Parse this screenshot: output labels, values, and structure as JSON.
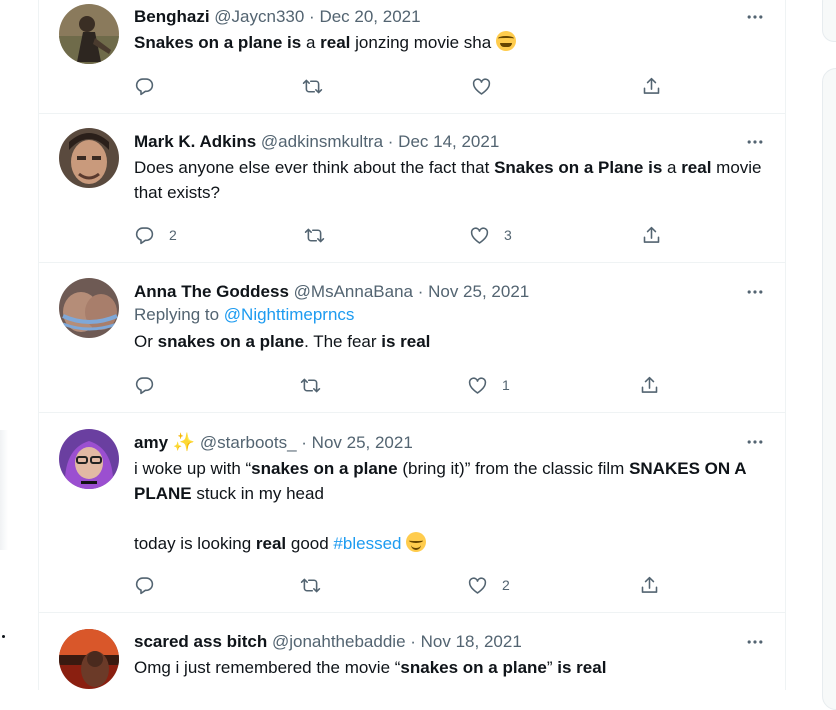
{
  "tweets": [
    {
      "name": "Benghazi",
      "handle": "@Jaycn330",
      "sep": " · ",
      "date": "Dec 20, 2021",
      "text": [
        {
          "t": "Snakes on a plane is",
          "b": true
        },
        {
          "t": " a ",
          "b": false
        },
        {
          "t": "real",
          "b": true
        },
        {
          "t": " jonzing movie sha ",
          "b": false
        }
      ],
      "emoji": "face-with-tears-of-joy",
      "replies": "",
      "retweets": "",
      "likes": ""
    },
    {
      "name": "Mark K. Adkins",
      "handle": "@adkinsmkultra",
      "sep": " · ",
      "date": "Dec 14, 2021",
      "text": [
        {
          "t": "Does anyone else ever think about the fact that ",
          "b": false
        },
        {
          "t": "Snakes on a Plane is",
          "b": true
        },
        {
          "t": " a ",
          "b": false
        },
        {
          "t": "real",
          "b": true
        },
        {
          "t": " movie that exists?",
          "b": false
        }
      ],
      "replies": "2",
      "retweets": "",
      "likes": "3"
    },
    {
      "name": "Anna The Goddess",
      "handle": "@MsAnnaBana",
      "sep": " · ",
      "date": "Nov 25, 2021",
      "replying_label": "Replying to ",
      "replying_to": "@Nighttimeprncs",
      "text": [
        {
          "t": "Or ",
          "b": false
        },
        {
          "t": "snakes on a plane",
          "b": true
        },
        {
          "t": ". The fear ",
          "b": false
        },
        {
          "t": "is real",
          "b": true
        }
      ],
      "replies": "",
      "retweets": "",
      "likes": "1"
    },
    {
      "name": "amy",
      "handle": "@starboots_",
      "sep": " · ",
      "date": "Nov 25, 2021",
      "text": [
        {
          "t": "i woke up with “",
          "b": false
        },
        {
          "t": "snakes on a plane",
          "b": true
        },
        {
          "t": " (bring it)” from the classic film ",
          "b": false
        },
        {
          "t": "SNAKES ON A PLANE",
          "b": true
        },
        {
          "t": " stuck in my head",
          "b": false
        }
      ],
      "text2_a": "today is looking ",
      "text2_b": "real",
      "text2_c": " good ",
      "hashtag": "#blessed",
      "emoji": "relieved-face",
      "replies": "",
      "retweets": "",
      "likes": "2"
    },
    {
      "name": "scared ass bitch",
      "handle": "@jonahthebaddie",
      "sep": " · ",
      "date": "Nov 18, 2021",
      "text": [
        {
          "t": "Omg i just remembered the movie “",
          "b": false
        },
        {
          "t": "snakes on a plane",
          "b": true
        },
        {
          "t": "” ",
          "b": false
        },
        {
          "t": "is real",
          "b": true
        }
      ]
    }
  ],
  "icons": {
    "more": "more-horizontal-icon",
    "reply": "reply-icon",
    "retweet": "retweet-icon",
    "like": "heart-icon",
    "share": "share-icon"
  },
  "colors": {
    "link": "#1d9bf0",
    "secondary": "#536471",
    "text": "#0f1419",
    "border": "#eff3f4"
  }
}
